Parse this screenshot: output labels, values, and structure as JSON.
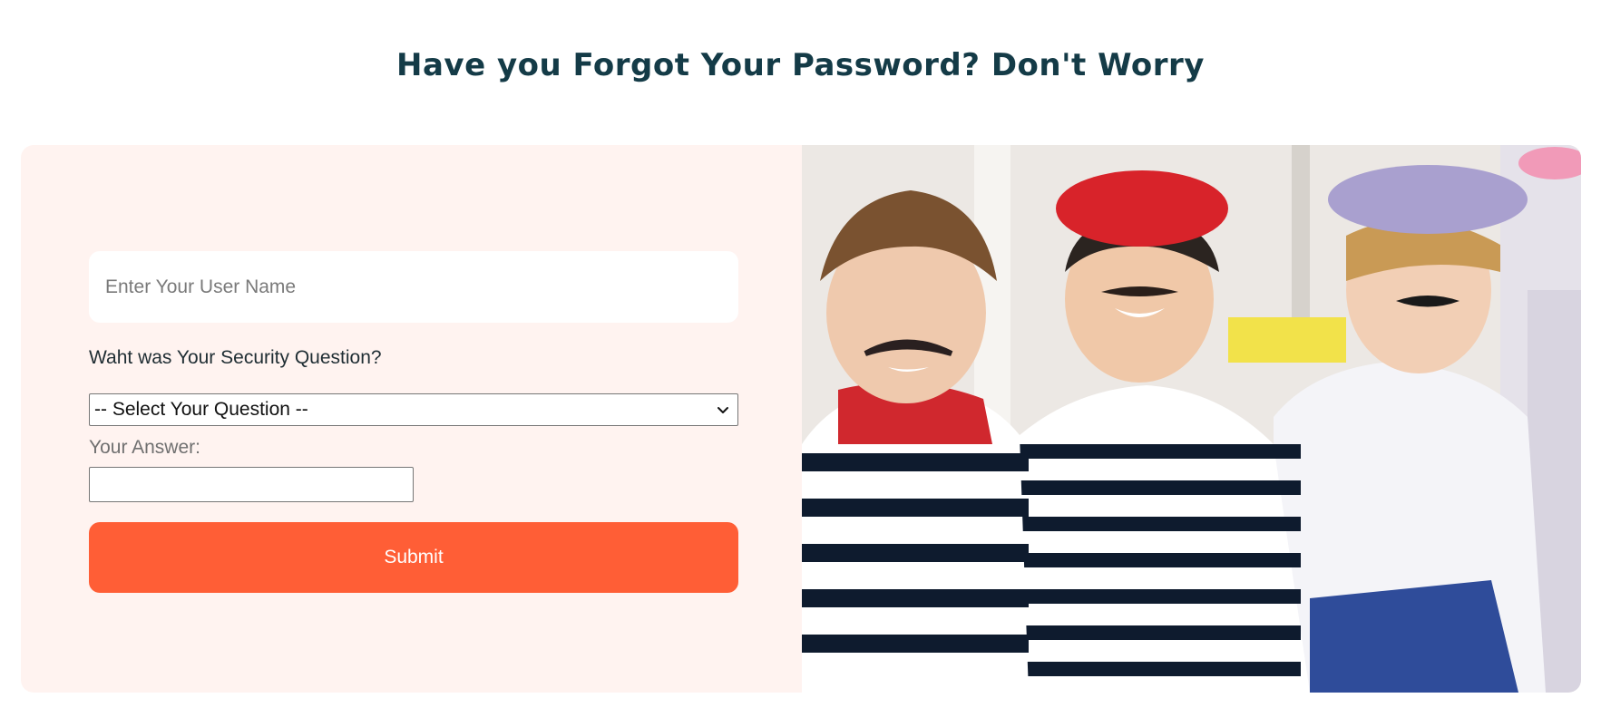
{
  "header": {
    "title": "Have you Forgot Your Password? Don't Worry"
  },
  "form": {
    "username_placeholder": "Enter Your User Name",
    "question_label": "Waht was Your Security Question?",
    "question_select_value": "-- Select Your Question --",
    "answer_label": "Your Answer:",
    "answer_value": "",
    "submit_label": "Submit"
  },
  "colors": {
    "accent": "#ff5e36",
    "card_background": "#fff3f0",
    "title": "#143b47"
  },
  "photo": {
    "icon": "kids-costume-photo"
  }
}
